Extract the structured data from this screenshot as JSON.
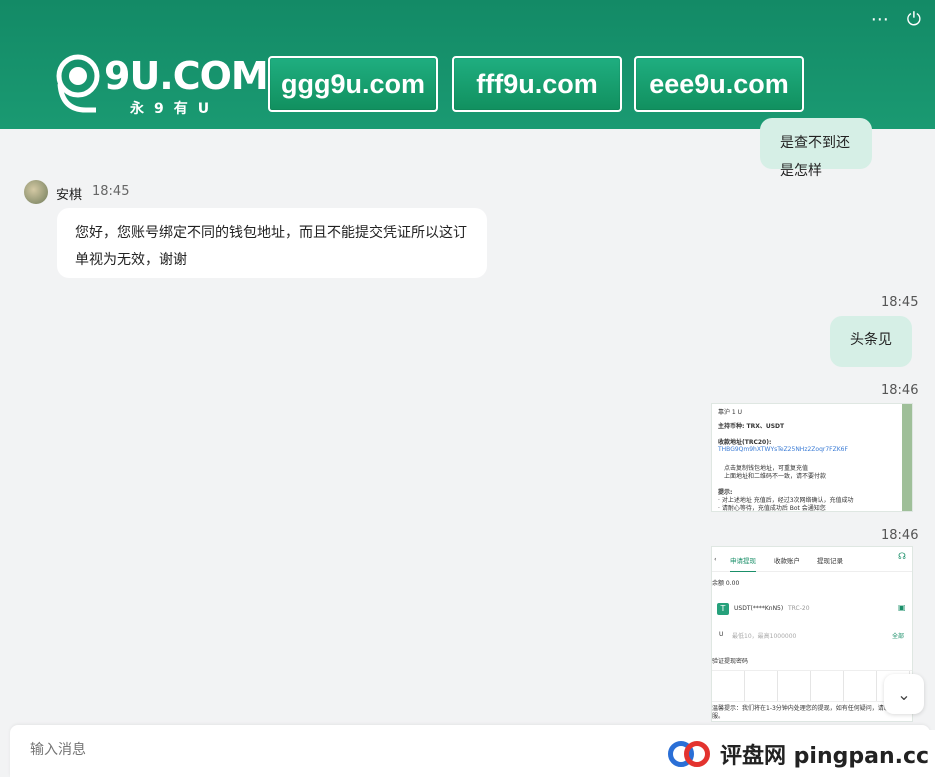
{
  "header": {
    "logo_main": "9U.COM",
    "logo_sub": "永9有U",
    "domains": [
      "ggg9u.com",
      "fff9u.com",
      "eee9u.com"
    ],
    "icons": [
      "more-icon",
      "power-icon"
    ]
  },
  "messages": {
    "m0": {
      "text": "是查不到还是怎样"
    },
    "m1": {
      "sender": "安棋",
      "time": "18:45",
      "text_line1": "您好，您账号绑定不同的钱包地址，而且不能提交凭证所以这订",
      "text_line2": "单视为无效，谢谢"
    },
    "m2": {
      "time": "18:45",
      "text": "头条见"
    },
    "m3": {
      "time": "18:46"
    },
    "m4": {
      "time": "18:46"
    }
  },
  "shot1": {
    "lines": [
      "靠沪 1 U",
      "主持币种: TRX、USDT",
      "收款地址(TRC20):",
      "THBG9Qm9hXTWYsTeZ25NHz2Zoqr7FZK6F",
      "点击复制钱包地址，可重复充值",
      "上面地址和二维码不一致，请不要付款",
      "提示:",
      "· 对上述地址 充值后，经过3次网络确认，充值成功",
      "· 请耐心等待，充值成功后 Bot 会通知您"
    ]
  },
  "shot2": {
    "tabs": [
      "申请提现",
      "收款账户",
      "提现记录"
    ],
    "balance": "余额 0.00",
    "coin": "USDT(****KnN5)",
    "network": "TRC-20",
    "amount_placeholder": "最低10，最高1000000",
    "all": "全部",
    "verify": "验证提现密码",
    "tip": "温馨提示：我们将在1-3分钟内处理您的提现，如有任何疑问，请联系客服。"
  },
  "input": {
    "placeholder": "输入消息"
  },
  "watermark": {
    "text": "评盘网 pingpan.cc"
  },
  "colors": {
    "brand": "#138a66",
    "bubble_self": "#d6efe6",
    "bg": "#f2f3f4"
  }
}
